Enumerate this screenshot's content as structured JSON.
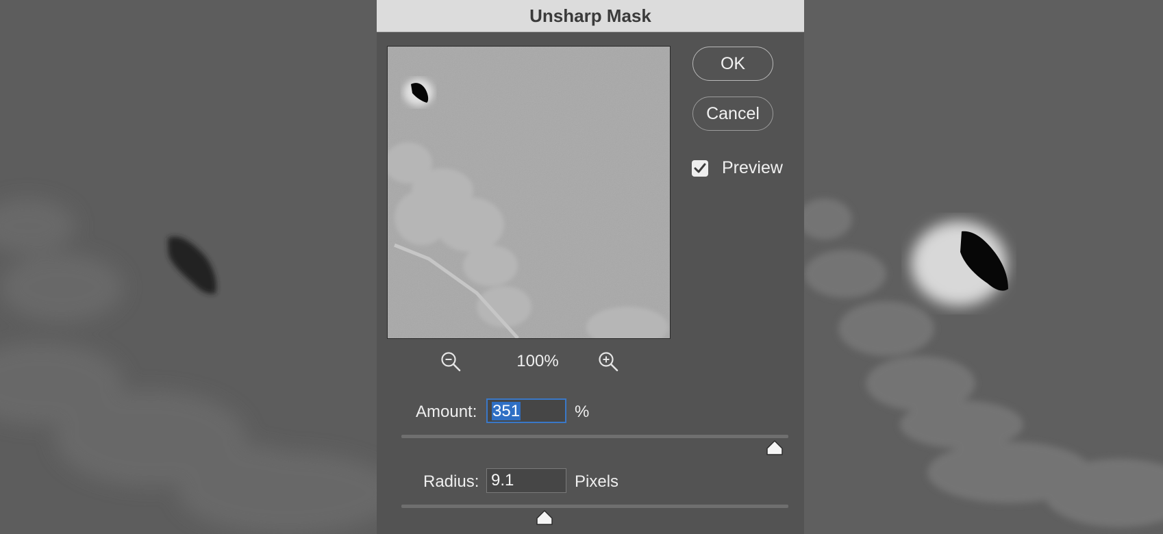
{
  "dialog": {
    "title": "Unsharp Mask",
    "ok_label": "OK",
    "cancel_label": "Cancel",
    "preview_label": "Preview",
    "preview_checked": true,
    "zoom_level": "100%",
    "amount": {
      "label": "Amount:",
      "value": "351",
      "unit": "%",
      "slider_fraction": 0.88
    },
    "radius": {
      "label": "Radius:",
      "value": "9.1",
      "unit": "Pixels",
      "slider_fraction": 0.37
    }
  },
  "icons": [
    "zoom-out-icon",
    "zoom-in-icon",
    "checkmark-icon",
    "slider-thumb-icon"
  ],
  "colors": {
    "dialog_bg": "#535353",
    "titlebar_bg": "#dcdcdc",
    "selection": "#2f6fc4",
    "focus_ring": "#3a78c8"
  }
}
